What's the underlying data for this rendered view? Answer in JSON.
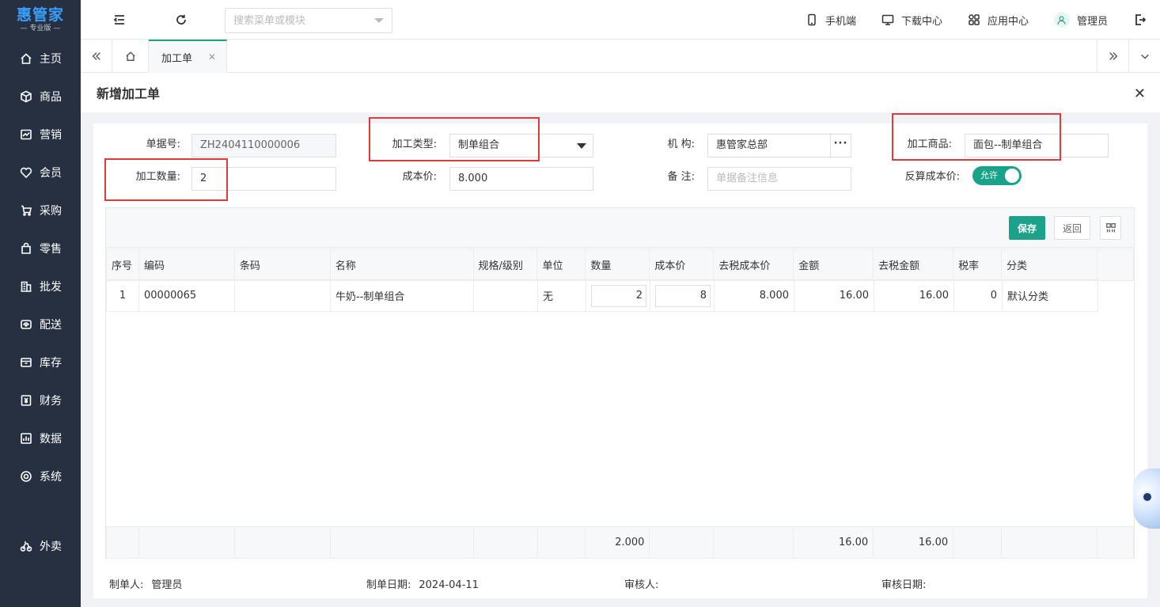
{
  "logo": {
    "main": "惠管家",
    "sub": "— 专业版 —"
  },
  "sidebar": {
    "items": [
      {
        "label": "主页",
        "icon": "home-icon"
      },
      {
        "label": "商品",
        "icon": "box-icon"
      },
      {
        "label": "营销",
        "icon": "chart-icon"
      },
      {
        "label": "会员",
        "icon": "heart-icon"
      },
      {
        "label": "采购",
        "icon": "cart-icon"
      },
      {
        "label": "零售",
        "icon": "bag-icon"
      },
      {
        "label": "批发",
        "icon": "building-icon"
      },
      {
        "label": "配送",
        "icon": "truck-icon"
      },
      {
        "label": "库存",
        "icon": "archive-icon"
      },
      {
        "label": "财务",
        "icon": "yen-icon"
      },
      {
        "label": "数据",
        "icon": "bar-chart-icon"
      },
      {
        "label": "系统",
        "icon": "gear-icon"
      },
      {
        "label": "外卖",
        "icon": "bike-icon"
      }
    ]
  },
  "header": {
    "search_placeholder": "搜索菜单或模块",
    "mobile": "手机端",
    "download": "下载中心",
    "apps": "应用中心",
    "user": "管理员"
  },
  "tabs": {
    "active": "加工单"
  },
  "dialog": {
    "title": "新增加工单"
  },
  "form": {
    "doc_no_label": "单据号:",
    "doc_no": "ZH2404110000006",
    "type_label": "加工类型:",
    "type": "制单组合",
    "org_label": "机 构:",
    "org": "惠管家总部",
    "product_label": "加工商品:",
    "product": "面包--制单组合",
    "qty_label": "加工数量:",
    "qty": "2",
    "cost_label": "成本价:",
    "cost": "8.000",
    "remark_label": "备 注:",
    "remark_placeholder": "单据备注信息",
    "reverse_label": "反算成本价:",
    "reverse_value": "允许"
  },
  "toolbar": {
    "save": "保存",
    "back": "返回"
  },
  "table": {
    "columns": [
      "序号",
      "编码",
      "条码",
      "名称",
      "规格/级别",
      "单位",
      "数量",
      "成本价",
      "去税成本价",
      "金额",
      "去税金额",
      "税率",
      "分类"
    ],
    "rows": [
      {
        "seq": "1",
        "code": "00000065",
        "barcode": "",
        "name": "牛奶--制单组合",
        "spec": "",
        "unit": "无",
        "qty": "2",
        "cost": "8",
        "cost_ex": "8.000",
        "amount": "16.00",
        "amount_ex": "16.00",
        "tax": "0",
        "category": "默认分类"
      }
    ],
    "footer": {
      "qty": "2.000",
      "amount": "16.00",
      "amount_ex": "16.00"
    }
  },
  "meta": {
    "maker_label": "制单人:",
    "maker": "管理员",
    "date_label": "制单日期:",
    "date": "2024-04-11",
    "auditor_label": "审核人:",
    "auditor": "",
    "audit_date_label": "审核日期:",
    "audit_date": ""
  }
}
